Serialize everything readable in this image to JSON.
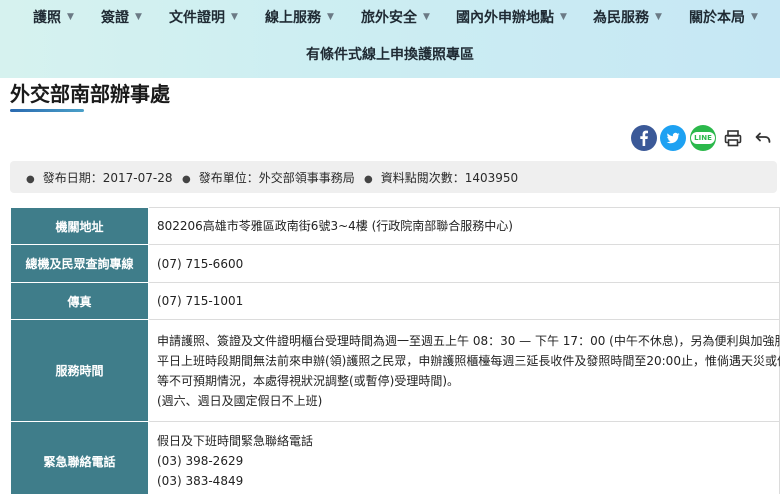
{
  "nav": {
    "items": [
      {
        "label": "護照"
      },
      {
        "label": "簽證"
      },
      {
        "label": "文件證明"
      },
      {
        "label": "線上服務"
      },
      {
        "label": "旅外安全"
      },
      {
        "label": "國內外申辦地點"
      },
      {
        "label": "為民服務"
      },
      {
        "label": "關於本局"
      }
    ],
    "chevron": "chevron-down-icon",
    "promo_link": "有條件式線上申換護照專區"
  },
  "page": {
    "title": "外交部南部辦事處"
  },
  "share": {
    "icons": [
      "facebook-icon",
      "twitter-icon",
      "line-icon",
      "print-icon",
      "back-icon"
    ],
    "colors": {
      "facebook": "#3b5998",
      "twitter": "#1da1f2",
      "line": "#2bb84b"
    },
    "line_text": "LINE"
  },
  "meta": {
    "publish_date": "發布日期：2017-07-28",
    "publisher": "發布單位：外交部領事事務局",
    "views": "資料點閱次數：1403950"
  },
  "table": {
    "address": {
      "label": "機關地址",
      "value": "802206高雄市苓雅區政南街6號3~4樓 (行政院南部聯合服務中心)"
    },
    "phone": {
      "label": "總機及民眾查詢專線",
      "value": "(07) 715-6600"
    },
    "fax": {
      "label": "傳真",
      "value": "(07) 715-1001"
    },
    "hours": {
      "label": "服務時間",
      "lines": [
        "申請護照、簽證及文件證明櫃台受理時間為週一至週五上午 08：30 — 下午 17：00 (中午不休息)，另為便利與加強服務",
        "平日上班時段期間無法前來申辦(領)護照之民眾，申辦護照櫃檯每週三延長收件及發照時間至20:00止，惟倘遇天災或停電",
        "等不可預期情況，本處得視狀況調整(或暫停)受理時間)。",
        "(週六、週日及國定假日不上班)"
      ]
    },
    "emergency": {
      "label": "緊急聯絡電話",
      "lines": [
        "假日及下班時間緊急聯絡電話",
        "(03) 398-2629",
        "(03) 383-4849"
      ]
    },
    "header_color": "#3f7d8a"
  }
}
